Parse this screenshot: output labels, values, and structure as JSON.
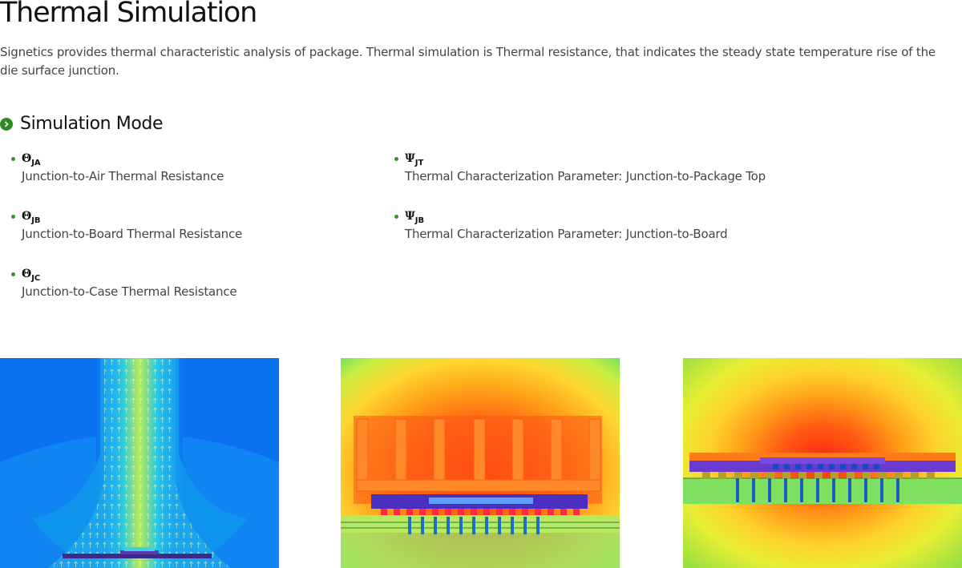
{
  "page": {
    "title": "Thermal Simulation",
    "intro": "Signetics provides thermal characteristic analysis of package. Thermal simulation is Thermal resistance, that indicates the steady state temperature rise of the die surface junction."
  },
  "section": {
    "title": "Simulation Mode",
    "icon": "chevron-right-icon",
    "accent": "#2e8b24"
  },
  "modes_left": [
    {
      "symbol": "Θ",
      "sub": "JA",
      "desc": "Junction-to-Air Thermal Resistance"
    },
    {
      "symbol": "Θ",
      "sub": "JB",
      "desc": "Junction-to-Board Thermal Resistance"
    },
    {
      "symbol": "Θ",
      "sub": "JC",
      "desc": "Junction-to-Case Thermal Resistance"
    }
  ],
  "modes_right": [
    {
      "symbol": "Ψ",
      "sub": "JT",
      "desc": "Thermal Characterization Parameter: Junction-to-Package Top"
    },
    {
      "symbol": "Ψ",
      "sub": "JB",
      "desc": "Thermal Characterization Parameter: Junction-to-Board"
    }
  ],
  "images": [
    {
      "name": "airflow-simulation-image"
    },
    {
      "name": "heatsink-simulation-image"
    },
    {
      "name": "board-simulation-image"
    }
  ]
}
